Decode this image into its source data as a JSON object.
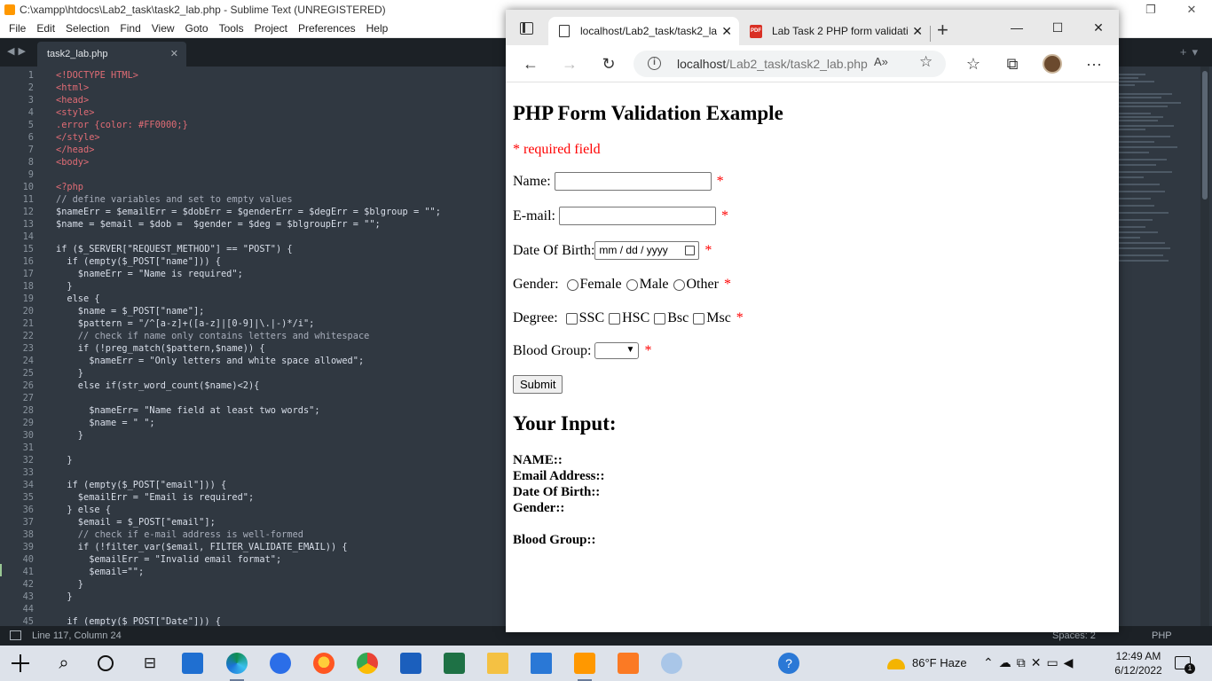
{
  "sublime": {
    "title": "C:\\xampp\\htdocs\\Lab2_task\\task2_lab.php - Sublime Text (UNREGISTERED)",
    "menu": [
      "File",
      "Edit",
      "Selection",
      "Find",
      "View",
      "Goto",
      "Tools",
      "Project",
      "Preferences",
      "Help"
    ],
    "tab_label": "task2_lab.php",
    "status_position": "Line 117, Column 24",
    "status_spaces": "Spaces: 2",
    "status_syntax": "PHP",
    "code_lines": [
      "<!DOCTYPE HTML>",
      "<html>",
      "<head>",
      "<style>",
      ".error {color: #FF0000;}",
      "</style>",
      "</head>",
      "<body>",
      "",
      "<?php",
      "// define variables and set to empty values",
      "$nameErr = $emailErr = $dobErr = $genderErr = $degErr = $blgroup = \"\";",
      "$name = $email = $dob =  $gender = $deg = $blgroupErr = \"\";",
      "",
      "if ($_SERVER[\"REQUEST_METHOD\"] == \"POST\") {",
      "  if (empty($_POST[\"name\"])) {",
      "    $nameErr = \"Name is required\";",
      "  }",
      "  else {",
      "    $name = $_POST[\"name\"];",
      "    $pattern = \"/^[a-z]+([a-z]|[0-9]|\\.|-)*/i\";",
      "    // check if name only contains letters and whitespace",
      "    if (!preg_match($pattern,$name)) {",
      "      $nameErr = \"Only letters and white space allowed\";",
      "    }",
      "    else if(str_word_count($name)<2){",
      "",
      "      $nameErr= \"Name field at least two words\";",
      "      $name = \" \";",
      "    }",
      "",
      "  }",
      "",
      "  if (empty($_POST[\"email\"])) {",
      "    $emailErr = \"Email is required\";",
      "  } else {",
      "    $email = $_POST[\"email\"];",
      "    // check if e-mail address is well-formed",
      "    if (!filter_var($email, FILTER_VALIDATE_EMAIL)) {",
      "      $emailErr = \"Invalid email format\";",
      "      $email=\"\";",
      "    }",
      "  }",
      "",
      "  if (empty($_POST[\"Date\"])) {"
    ]
  },
  "edge": {
    "tab1_title": "localhost/Lab2_task/task2_la",
    "tab2_title": "Lab Task 2 PHP form validati",
    "address_host": "localhost",
    "address_path": "/Lab2_task/task2_lab.php",
    "read_aloud": "A»",
    "page": {
      "heading": "PHP Form Validation Example",
      "required_note": "* required field",
      "name_label": "Name:",
      "email_label": "E-mail:",
      "dob_label": "Date Of Birth:",
      "dob_placeholder": "mm / dd / yyyy",
      "gender_label": "Gender:",
      "gender_options": [
        "Female",
        "Male",
        "Other"
      ],
      "degree_label": "Degree:",
      "degree_options": [
        "SSC",
        "HSC",
        "Bsc",
        "Msc"
      ],
      "blood_label": "Blood Group:",
      "required_star": "*",
      "submit_label": "Submit",
      "output_heading": "Your Input:",
      "output_name": "NAME::",
      "output_email": "Email Address::",
      "output_dob": "Date Of Birth::",
      "output_gender": "Gender::",
      "output_blood": "Blood Group::"
    }
  },
  "taskbar": {
    "weather": "86°F  Haze",
    "time": "12:49 AM",
    "date": "6/12/2022",
    "notifications": "1"
  }
}
